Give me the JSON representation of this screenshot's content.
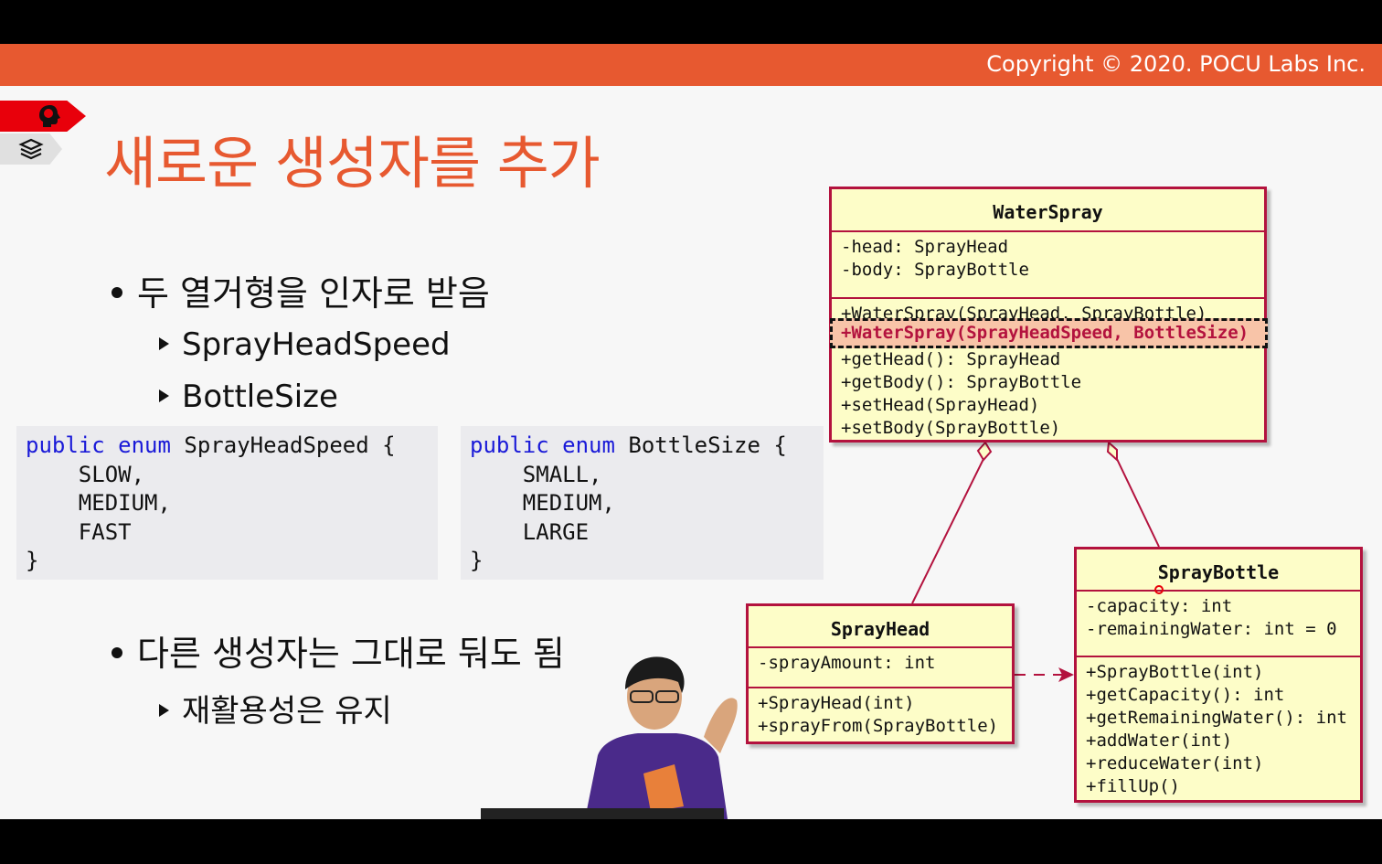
{
  "header": {
    "copyright": "Copyright © 2020. POCU Labs Inc."
  },
  "icons": {
    "brain": "brain-icon",
    "books": "books-icon"
  },
  "colors": {
    "accent": "#e75930",
    "uml_border": "#b3123e",
    "uml_fill": "#fdfdc8",
    "keyword": "#1a1ad8"
  },
  "title": "새로운 생성자를 추가",
  "bullets": [
    {
      "text": "두 열거형을 인자로 받음",
      "subs": [
        "SprayHeadSpeed",
        "BottleSize"
      ]
    },
    {
      "text": "다른 생성자는 그대로 둬도 됨",
      "subs": [
        "재활용성은 유지"
      ]
    }
  ],
  "code_blocks": [
    {
      "kw1": "public",
      "kw2": "enum",
      "name": "SprayHeadSpeed {",
      "items": [
        "    SLOW,",
        "    MEDIUM,",
        "    FAST"
      ],
      "close": "}"
    },
    {
      "kw1": "public",
      "kw2": "enum",
      "name": "BottleSize {",
      "items": [
        "    SMALL,",
        "    MEDIUM,",
        "    LARGE"
      ],
      "close": "}"
    }
  ],
  "uml": {
    "water_spray": {
      "name": "WaterSpray",
      "fields": [
        "-head: SprayHead",
        "-body: SprayBottle"
      ],
      "methods": [
        "+WaterSpray(SprayHead, SprayBottle)",
        "+getHead(): SprayHead",
        "+getBody(): SprayBottle",
        "+setHead(SprayHead)",
        "+setBody(SprayBottle)"
      ],
      "highlighted": "+WaterSpray(SprayHeadSpeed, BottleSize)"
    },
    "spray_head": {
      "name": "SprayHead",
      "fields": [
        "-sprayAmount: int"
      ],
      "methods": [
        "+SprayHead(int)",
        "+sprayFrom(SprayBottle)"
      ]
    },
    "spray_bottle": {
      "name": "SprayBottle",
      "fields": [
        "-capacity: int",
        "-remainingWater: int = 0"
      ],
      "methods": [
        "+SprayBottle(int)",
        "+getCapacity(): int",
        "+getRemainingWater(): int",
        "+addWater(int)",
        "+reduceWater(int)",
        "+fillUp()"
      ]
    }
  }
}
